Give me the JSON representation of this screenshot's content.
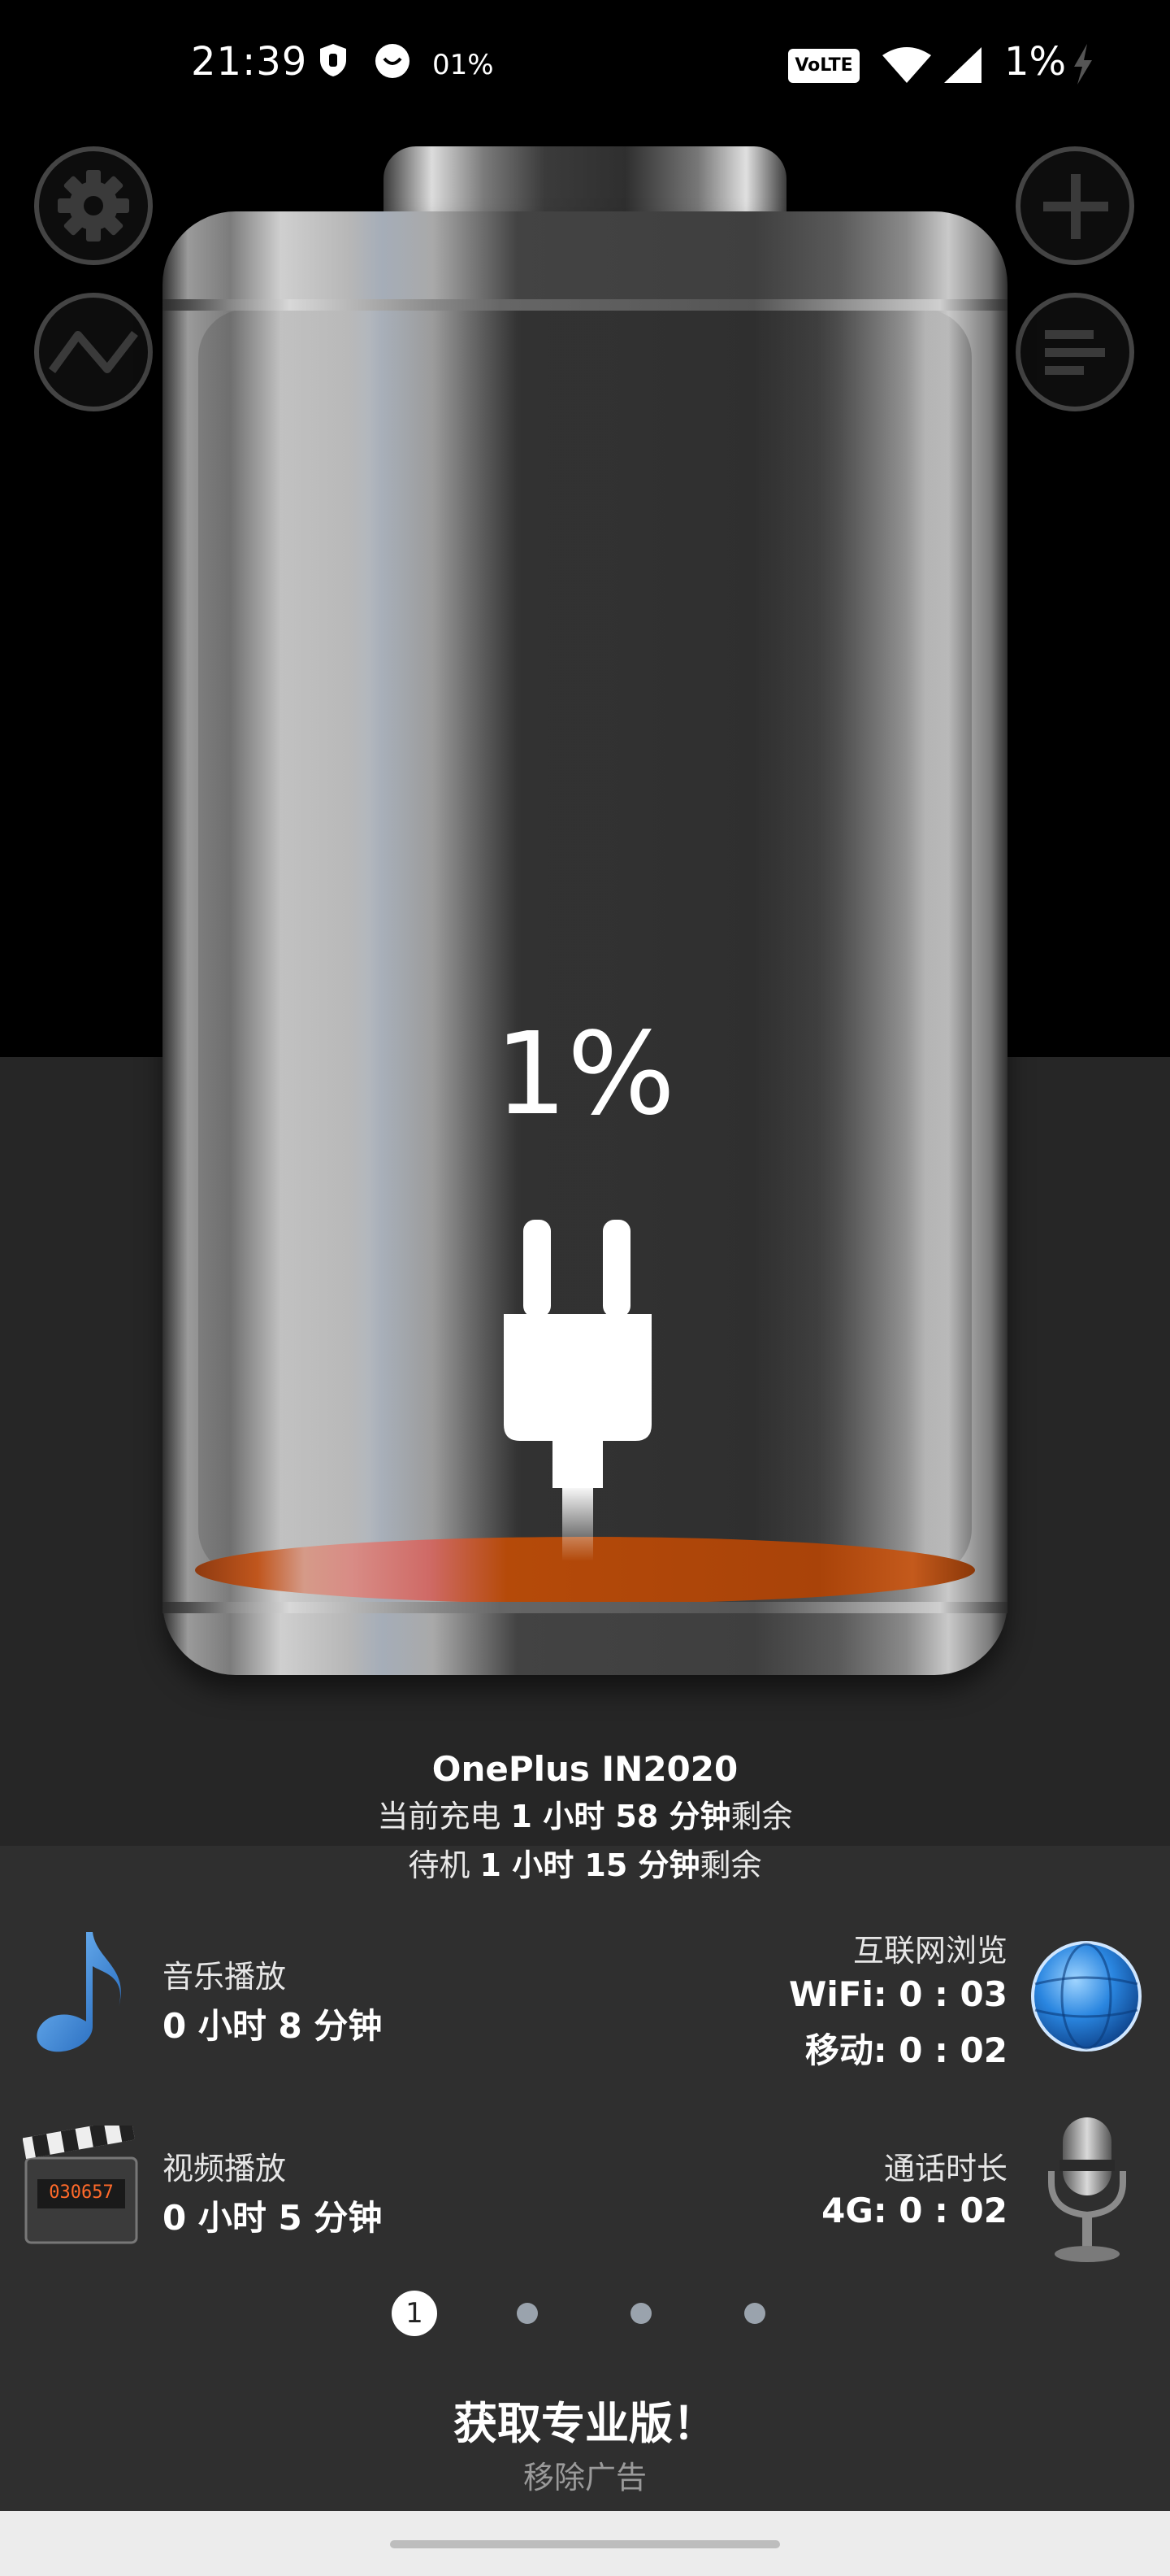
{
  "status_bar": {
    "time": "21:39",
    "small_percent": "01%",
    "volte": "VoLTE",
    "battery_percent": "1%"
  },
  "side_buttons": {
    "settings_icon": "gear-icon",
    "chart_icon": "graph-icon",
    "add_icon": "plus-icon",
    "list_icon": "list-icon"
  },
  "battery": {
    "level_percent": "1%",
    "level_fraction": 0.01,
    "state_icon": "plug-icon",
    "fill_color": "#b54a09"
  },
  "device": {
    "name": "OnePlus IN2020",
    "charge_prefix": "当前充电",
    "charge_time": "1 小时 58 分钟",
    "charge_suffix": "剩余",
    "standby_prefix": "待机",
    "standby_time": "1 小时 15 分钟",
    "standby_suffix": "剩余"
  },
  "usage": {
    "music": {
      "label": "音乐播放",
      "value": "0 小时 8 分钟",
      "icon": "music-note-icon"
    },
    "internet": {
      "label": "互联网浏览",
      "wifi": "WiFi: 0 : 03",
      "mobile": "移动: 0 : 02",
      "icon": "globe-icon"
    },
    "video": {
      "label": "视频播放",
      "value": "0 小时 5 分钟",
      "icon": "clapperboard-icon",
      "counter": "030657"
    },
    "call": {
      "label": "通话时长",
      "value": "4G: 0 : 02",
      "icon": "microphone-icon"
    }
  },
  "pager": {
    "active": "1",
    "count": 4
  },
  "promo": {
    "title": "获取专业版！",
    "subtitle": "移除广告"
  }
}
